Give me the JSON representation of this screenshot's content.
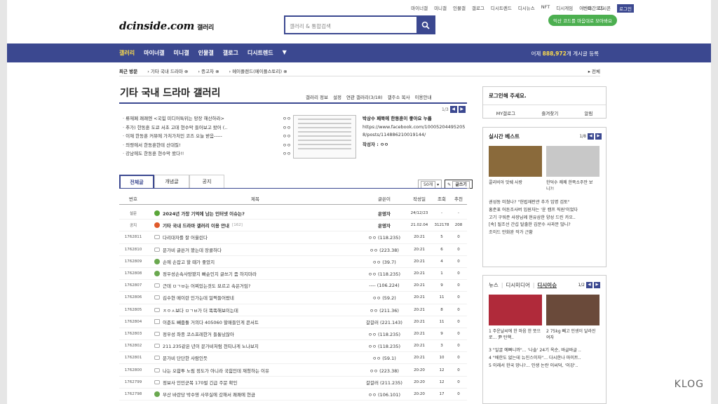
{
  "top_links": [
    "마이너갤",
    "미니갤",
    "인물갤",
    "갤로그",
    "디시트렌드",
    "디시뉴스",
    "NFT",
    "디시게임",
    "이벤트",
    "디시콘"
  ],
  "login_link": "로그인",
  "night_mode": "야간모드",
  "logo": {
    "main": "dcinside.com",
    "sub": "갤러리"
  },
  "search": {
    "placeholder": "갤러리 & 통합검색"
  },
  "promo": "익산 코드를 마음대로 모아봐요",
  "nav": {
    "items": [
      "갤러리",
      "마이너갤",
      "미니갤",
      "인물갤",
      "갤로그",
      "디시트렌드"
    ],
    "active": 0
  },
  "visitors": {
    "prefix": "어제",
    "count": "888,972",
    "suffix": "개 게시글 등록"
  },
  "recent": {
    "label": "최근 방문",
    "items": [
      "기타 국내 드라마",
      "증고차",
      "메이플랜드(메이플스토리)"
    ],
    "all": "전체"
  },
  "gallery": {
    "title": "기타 국내 드라마 갤러리",
    "tabs": [
      "갤러리 정보",
      "설정",
      "연관 갤러리(3/18)",
      "갤주소 복사",
      "이용안내"
    ],
    "pager": "1/3",
    "notices": [
      {
        "text": "· 류재페 쾌쾌엔 <국힘 미디어특위는 망장 해산하라>",
        "nick": "ㅇㅇ"
      },
      {
        "text": "· 추가) 한동훈 도쿄 서초 고데 현수막 들어보고 왔어 (..",
        "nick": "ㅇㅇ"
      },
      {
        "text": "· 이재 한동훈 커뮤에 가처가처인 코즈 오늘 받음-----",
        "nick": "ㅇㅇ"
      },
      {
        "text": "· 의령에서 한동훈한테 산대질!",
        "nick": "ㅇㅇ"
      },
      {
        "text": "· 강남에도 한동훈 현수막 왔다!!",
        "nick": "ㅇㅇ"
      }
    ],
    "featured": {
      "headline": "박상수 페북에 한동훈이 좋아요 누름",
      "body": "https://www.facebook.com/100052044952058/posts/114886210019144/",
      "writer": "작성자 : ㅇㅇ"
    }
  },
  "list_tabs": [
    "전체글",
    "개념글",
    "공지"
  ],
  "row_count": "50개",
  "write_button": "글쓰기",
  "table": {
    "headers": [
      "번호",
      "제목",
      "글쓴이",
      "작성일",
      "조회",
      "추천"
    ],
    "rows": [
      {
        "num": "설문",
        "icon": "g",
        "title": "2024년 가장 기억에 남는 인터넷 이슈는?",
        "comments": "",
        "writer": "운영자",
        "date": "24/12/23",
        "views": "-",
        "rec": "-",
        "bold": true
      },
      {
        "num": "공지",
        "icon": "r",
        "title": "기타 국내 드라마 갤러리 이용 안내",
        "comments": "[162]",
        "writer": "운영자",
        "date": "21.02.04",
        "views": "312178",
        "rec": "208",
        "bold": true
      },
      {
        "num": "1762811",
        "icon": "t",
        "title": "다리대자를 잘 어울린다",
        "comments": "",
        "writer": "ㅇㅇ (118.235)",
        "date": "20:21",
        "views": "5",
        "rec": "0",
        "bold": false
      },
      {
        "num": "1762810",
        "icon": "t",
        "title": "문가비 글쓴거 봤는데 장콜하다",
        "comments": "",
        "writer": "ㅇㅇ (223.38)",
        "date": "20:21",
        "views": "6",
        "rec": "0",
        "bold": false
      },
      {
        "num": "1762809",
        "icon": "gr",
        "title": "손에 손잡고 할 때가 좋았지",
        "comments": "",
        "writer": "ㅇㅇ (39.7)",
        "date": "20:21",
        "views": "4",
        "rec": "0",
        "bold": false
      },
      {
        "num": "1762808",
        "icon": "gr",
        "title": "정우성손속사망봤지 빠순인지 글쓰기 좀 하지마라",
        "comments": "",
        "writer": "ㅇㅇ (118.235)",
        "date": "20:21",
        "views": "1",
        "rec": "0",
        "bold": false
      },
      {
        "num": "1762807",
        "icon": "t",
        "title": "근데 ㅁㄱㅂ는 어찌있는것도 묘르고 속은거임?",
        "comments": "",
        "writer": "---- (106.224)",
        "date": "20:21",
        "views": "9",
        "rec": "0",
        "bold": false
      },
      {
        "num": "1762806",
        "icon": "t",
        "title": "김수현 메이란 인가는데 얼쩍들어왔네",
        "comments": "",
        "writer": "ㅇㅇ (59.2)",
        "date": "20:21",
        "views": "11",
        "rec": "0",
        "bold": false
      },
      {
        "num": "1762805",
        "icon": "t",
        "title": "ㅈㅇㅅ보다 ㅁㄱㅂ가 더 똑똑해보이는데",
        "comments": "",
        "writer": "ㅇㅇ (211.36)",
        "date": "20:21",
        "views": "8",
        "rec": "0",
        "bold": false
      },
      {
        "num": "1762804",
        "icon": "p",
        "title": "이준도 빼줍둘 거의다 405060 할매들인게 콘서트",
        "comments": "",
        "writer": "갈갈러 (221.143)",
        "date": "20:21",
        "views": "11",
        "rec": "0",
        "bold": false
      },
      {
        "num": "1762803",
        "icon": "t",
        "title": "정우성 좌종 코스프레한거 들통났잖아",
        "comments": "",
        "writer": "ㅇㅇ (118.235)",
        "date": "20:21",
        "views": "9",
        "rec": "0",
        "bold": false
      },
      {
        "num": "1762802",
        "icon": "t",
        "title": "211.235같은 년이 문가비처럼 천티나게 노나보지",
        "comments": "",
        "writer": "ㅇㅇ (118.235)",
        "date": "20:21",
        "views": "3",
        "rec": "0",
        "bold": false
      },
      {
        "num": "1762801",
        "icon": "t",
        "title": "문가비 단단한 사람인듯",
        "comments": "",
        "writer": "ㅇㅇ (59.1)",
        "date": "20:21",
        "views": "10",
        "rec": "0",
        "bold": false
      },
      {
        "num": "1762800",
        "icon": "t",
        "title": "나는 오합투 노림 정도가 아니라 국힘인데 재청하는 이유",
        "comments": "",
        "writer": "ㅇㅇ (223.38)",
        "date": "20:20",
        "views": "12",
        "rec": "0",
        "bold": false
      },
      {
        "num": "1762799",
        "icon": "t",
        "title": "정보사 인민군복 170벌 긴급 주문 확인",
        "comments": "",
        "writer": "갈갈러 (211.235)",
        "date": "20:20",
        "views": "12",
        "rec": "0",
        "bold": false
      },
      {
        "num": "1762798",
        "icon": "gr",
        "title": "부산 바란당 박수영 사무실에 갔해서 쾌쾌에 현금",
        "comments": "",
        "writer": "ㅇㅇ (106.101)",
        "date": "20:20",
        "views": "17",
        "rec": "0",
        "bold": false
      }
    ]
  },
  "sidebar": {
    "login": {
      "prompt": "로그인해 주세요.",
      "links": [
        "MY갤로그",
        "즐겨찾기",
        "알림"
      ]
    },
    "best": {
      "title": "실시간 베스트",
      "pager": "1/8",
      "cards": [
        {
          "caption": "콜리비아 맛쉐 사랑",
          "color": "#8a6a3b"
        },
        {
          "caption": "한덕수 쾌쾌 한쪽소주만 보니?!",
          "color": "#c8c8c8"
        }
      ],
      "list": [
        "권성동 미쳤나? \"헌법재판관 추가 임명 검토\"",
        "홍준표 어튼조사버 임원자는 '윤 캠프 직원'이었다",
        "고기 구워준 사장님께 현유삼한 양성 드린 카오..",
        "[속] 될조선 간섭 탈출한 김문수 사과문 많니?",
        "조이드 만화완 작가 근황"
      ]
    },
    "news": {
      "tabs": [
        "뉴스",
        "디시미디어",
        "디시이슈"
      ],
      "active": 2,
      "pager": "1/2",
      "cards": [
        {
          "caption": "1 주운날씨에 한 마음 한 뜻으로... 尹 탄핵..",
          "color": "#b02a3a"
        },
        {
          "caption": "2 75kg 빼고 인생이 달라진 여자",
          "color": "#6a4a3a"
        }
      ],
      "list": [
        "3 \"일굴 예뻐니까\"... '나솔' 24기 옥순, 바글바글 ..",
        "4 \"배한도 없는데 뉴진스이자\"... 다시한나 마이트..",
        "5 이래서 한국 망나?... 인생 논란 이씨덕, '이강'.."
      ]
    }
  },
  "watermark": "KLOG"
}
